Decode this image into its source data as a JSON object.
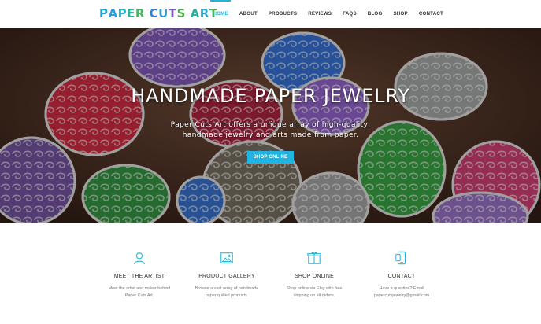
{
  "brand": {
    "logo_text": "PAPER CUTS ART",
    "logo_letters": [
      {
        "ch": "P",
        "color": "#1aa3d6"
      },
      {
        "ch": "A",
        "color": "#2a9fd8"
      },
      {
        "ch": "P",
        "color": "#22b2c9"
      },
      {
        "ch": "E",
        "color": "#2bb89b"
      },
      {
        "ch": "R",
        "color": "#43b85a"
      },
      {
        "ch": " ",
        "color": "#000000"
      },
      {
        "ch": "C",
        "color": "#3a7fd5"
      },
      {
        "ch": "U",
        "color": "#2c9bd9"
      },
      {
        "ch": "T",
        "color": "#7a5bc7"
      },
      {
        "ch": "S",
        "color": "#4fb04a"
      },
      {
        "ch": " ",
        "color": "#000000"
      },
      {
        "ch": "A",
        "color": "#2bb0a3"
      },
      {
        "ch": "R",
        "color": "#2aa5d9"
      },
      {
        "ch": "T",
        "color": "#4caf50"
      }
    ]
  },
  "nav": {
    "items": [
      {
        "label": "HOME",
        "active": true
      },
      {
        "label": "ABOUT",
        "active": false
      },
      {
        "label": "PRODUCTS",
        "active": false
      },
      {
        "label": "REVIEWS",
        "active": false
      },
      {
        "label": "FAQS",
        "active": false
      },
      {
        "label": "BLOG",
        "active": false
      },
      {
        "label": "SHOP",
        "active": false
      },
      {
        "label": "CONTACT",
        "active": false
      }
    ],
    "active_color": "#2ab3d8"
  },
  "hero": {
    "title": "HANDMADE PAPER JEWELRY",
    "subtitle": "Paper Cuts Art offers a unique array of high-quality, handmade jewelry and arts made from paper.",
    "button_label": "SHOP ONLINE",
    "button_color": "#20b4e3"
  },
  "features": [
    {
      "icon": "person-icon",
      "title": "MEET THE ARTIST",
      "desc": "Meet the artist and maker behind Paper Cuts Art."
    },
    {
      "icon": "image-gallery-icon",
      "title": "PRODUCT GALLERY",
      "desc": "Browse a vast array of handmade paper quilled products."
    },
    {
      "icon": "gift-box-icon",
      "title": "SHOP ONLINE",
      "desc": "Shop online via Etsy with free shipping on all orders."
    },
    {
      "icon": "phone-icon",
      "title": "CONTACT",
      "desc": "Have a question? Email papercutsjewelry@gmail.com"
    }
  ],
  "icon_color": "#2ab3d8"
}
